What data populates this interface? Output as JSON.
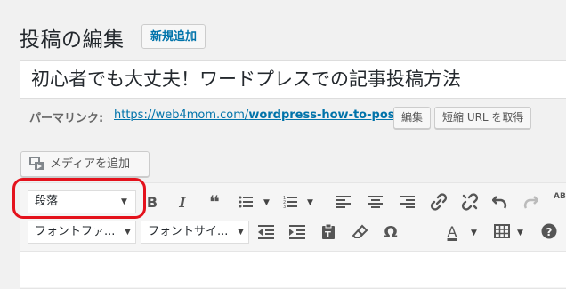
{
  "header": {
    "title": "投稿の編集",
    "add_new": "新規追加"
  },
  "post": {
    "title_value": "初心者でも大丈夫！ワードプレスでの記事投稿方法"
  },
  "permalink": {
    "label": "パーマリンク:",
    "url_prefix": "https://web4mom.com/",
    "url_slug": "wordpress-how-to-post",
    "url_suffix": "/",
    "edit_button": "編集",
    "shortlink_button": "短縮 URL を取得"
  },
  "media": {
    "add_media_label": "メディアを追加"
  },
  "toolbar": {
    "format_select": "段落",
    "font_family_select": "フォントファ...",
    "font_size_select": "フォントサイ...",
    "row1_icons": [
      "bold-icon",
      "italic-icon",
      "blockquote-icon",
      "bullet-list-icon",
      "numbered-list-icon",
      "align-left-icon",
      "align-center-icon",
      "align-right-icon",
      "link-icon",
      "unlink-icon",
      "undo-icon",
      "redo-icon",
      "spellcheck-icon"
    ],
    "row2_icons": [
      "outdent-icon",
      "indent-icon",
      "paste-text-icon",
      "clear-formatting-icon",
      "special-character-icon",
      "text-color-icon",
      "table-icon",
      "help-icon"
    ]
  },
  "colors": {
    "accent": "#0073aa",
    "highlight": "#e4121c"
  }
}
